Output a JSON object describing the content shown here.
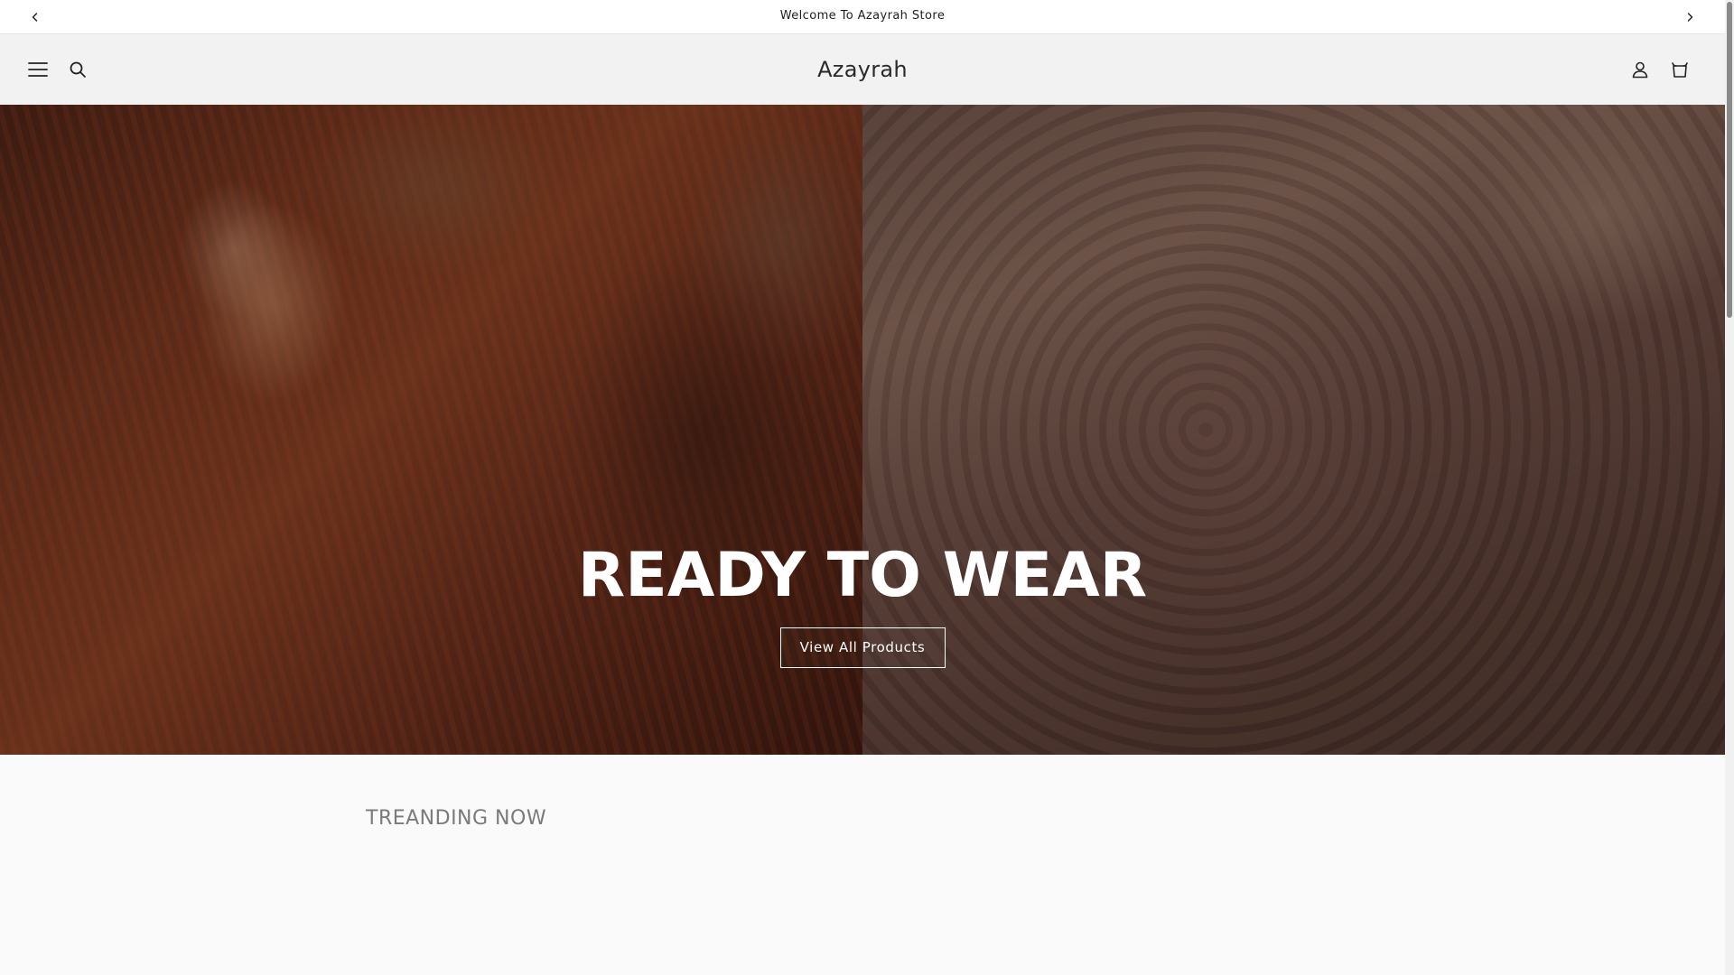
{
  "announcement": {
    "message": "Welcome To Azayrah Store",
    "prev_icon": "chevron-left-icon",
    "next_icon": "chevron-right-icon"
  },
  "header": {
    "brand": "Azayrah",
    "menu_icon": "menu-icon",
    "search_icon": "search-icon",
    "account_icon": "user-icon",
    "cart_icon": "cart-icon"
  },
  "hero": {
    "title": "READY TO WEAR",
    "button_label": "View All Products"
  },
  "trending": {
    "title": "TREANDING NOW"
  },
  "colors": {
    "text_dark": "#1e1e1e",
    "header_bg": "#f2f2f2",
    "hero_text": "#ffffff",
    "section_title": "#7a7a7a"
  }
}
